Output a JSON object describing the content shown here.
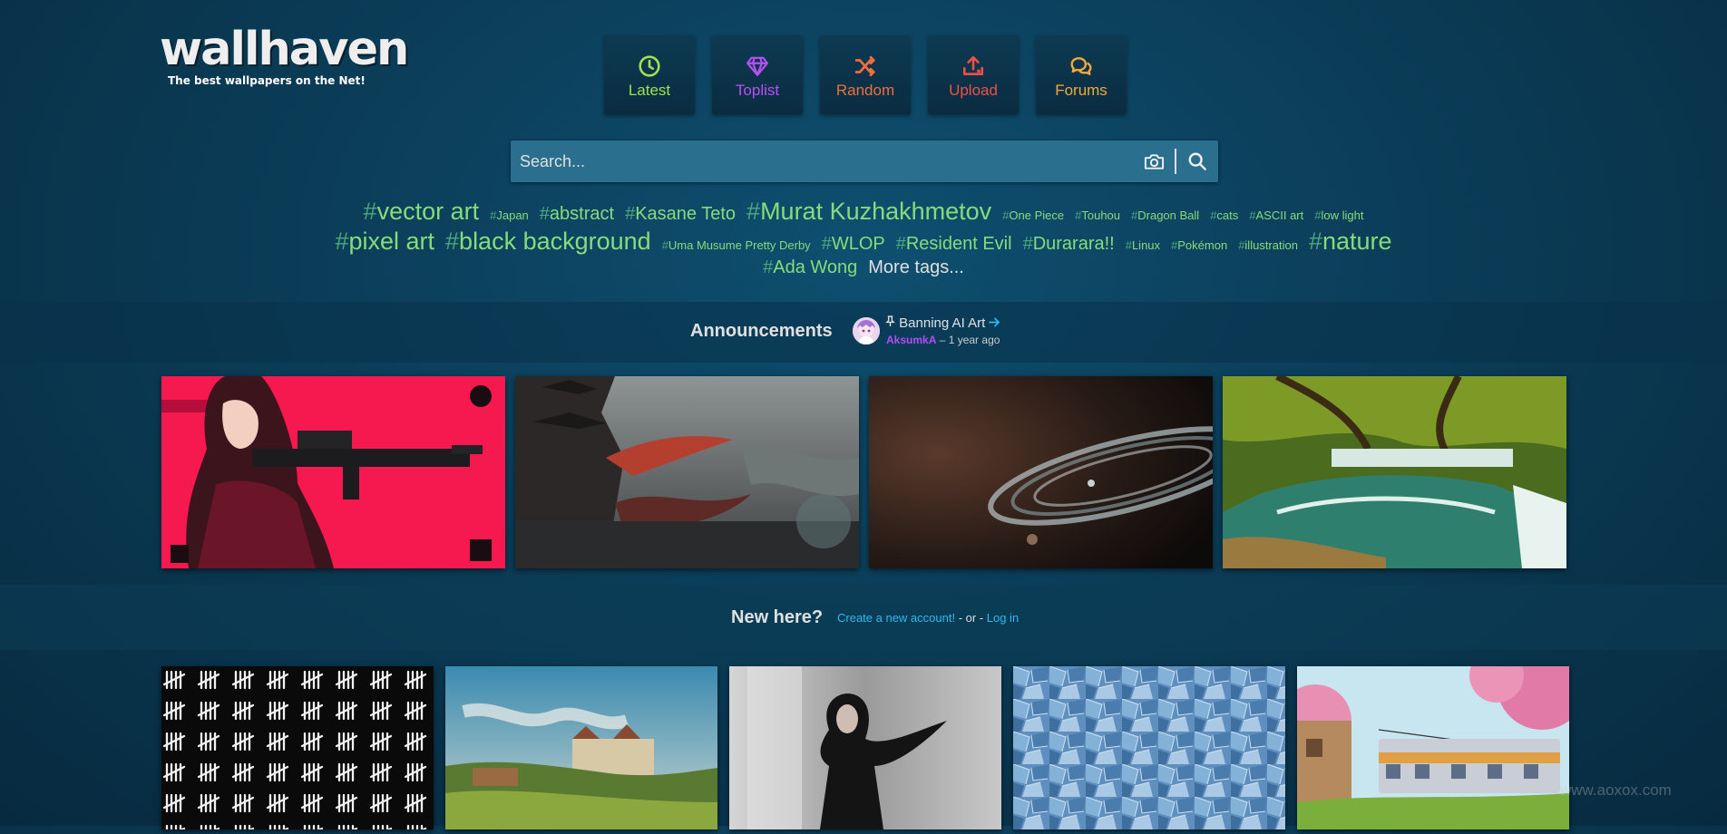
{
  "logo": {
    "title": "wallhaven",
    "subtitle": "The best wallpapers on the Net!"
  },
  "nav": [
    {
      "label": "Latest",
      "icon": "clock-icon",
      "color": "#9de24f"
    },
    {
      "label": "Toplist",
      "icon": "diamond-icon",
      "color": "#b750f7"
    },
    {
      "label": "Random",
      "icon": "shuffle-icon",
      "color": "#ee6f3c"
    },
    {
      "label": "Upload",
      "icon": "upload-icon",
      "color": "#ee4f48"
    },
    {
      "label": "Forums",
      "icon": "comments-icon",
      "color": "#f2aa3a"
    }
  ],
  "search": {
    "placeholder": "Search...",
    "value": ""
  },
  "tags": {
    "row1": [
      "vector art",
      "Japan",
      "abstract",
      "Kasane Teto",
      "Murat Kuzhakhmetov",
      "One Piece",
      "Touhou",
      "Dragon Ball",
      "cats",
      "ASCII art",
      "low light"
    ],
    "row2": [
      "pixel art",
      "black background",
      "Uma Musume Pretty Derby",
      "WLOP",
      "Resident Evil",
      "Durarara!!",
      "Linux",
      "Pokémon",
      "illustration",
      "nature"
    ],
    "row3": [
      "Ada Wong"
    ],
    "more": "More tags..."
  },
  "announcements": {
    "label": "Announcements",
    "title": "Banning AI Art",
    "user": "AksumkA",
    "time": "1 year ago",
    "separator": " – "
  },
  "featured": [
    "anime-girl-rifle",
    "dark-fantasy-dragon-temple",
    "planet-rings-space",
    "waterfall-lagoon-forest"
  ],
  "new_here": {
    "label": "New here?",
    "create": "Create a new account!",
    "or": " - or - ",
    "login": "Log in"
  },
  "recent": [
    "tally-marks-pattern",
    "castle-landscape-painting",
    "woman-black-hair-wind",
    "blue-crystal-texture",
    "train-cherry-blossom"
  ],
  "watermark": "www.aoxox.com",
  "colors": {
    "tag": "#86dc7a",
    "hash": "#4ea77a",
    "link": "#2ebaf0",
    "user": "#b34df2"
  }
}
